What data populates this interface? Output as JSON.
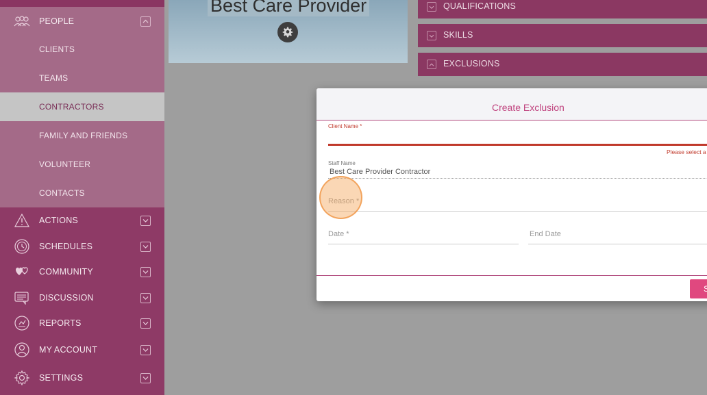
{
  "sidebar": {
    "main_items": [
      {
        "label": "PEOPLE",
        "icon": "people-icon"
      },
      {
        "label": "ACTIONS",
        "icon": "warning-icon"
      },
      {
        "label": "SCHEDULES",
        "icon": "clock-icon"
      },
      {
        "label": "COMMUNITY",
        "icon": "hearts-icon"
      },
      {
        "label": "DISCUSSION",
        "icon": "chat-icon"
      },
      {
        "label": "REPORTS",
        "icon": "reports-icon"
      },
      {
        "label": "MY ACCOUNT",
        "icon": "user-icon"
      },
      {
        "label": "SETTINGS",
        "icon": "gear-icon"
      }
    ],
    "people_subitems": [
      {
        "label": "CLIENTS",
        "active": false
      },
      {
        "label": "TEAMS",
        "active": false
      },
      {
        "label": "CONTRACTORS",
        "active": true
      },
      {
        "label": "FAMILY AND FRIENDS",
        "active": false
      },
      {
        "label": "VOLUNTEER",
        "active": false
      },
      {
        "label": "CONTACTS",
        "active": false
      }
    ]
  },
  "profile": {
    "title": "Best Care Provider"
  },
  "panels": [
    {
      "label": "QUALIFICATIONS"
    },
    {
      "label": "SKILLS"
    },
    {
      "label": "EXCLUSIONS"
    }
  ],
  "modal": {
    "title": "Create Exclusion",
    "client_name_label": "Client Name *",
    "client_name_error": "Please select a",
    "staff_name_label": "Staff Name",
    "staff_name_value": "Best Care Provider Contractor",
    "reason_label": "Reason *",
    "date_label": "Date *",
    "end_date_label": "End Date",
    "save_label": "S"
  },
  "colors": {
    "sidebar": "#8e3a66",
    "sidebar_people_bg": "#a46a88",
    "accent_pink": "#c0447f",
    "error_red": "#c0392b",
    "save_button": "#e0487f"
  }
}
